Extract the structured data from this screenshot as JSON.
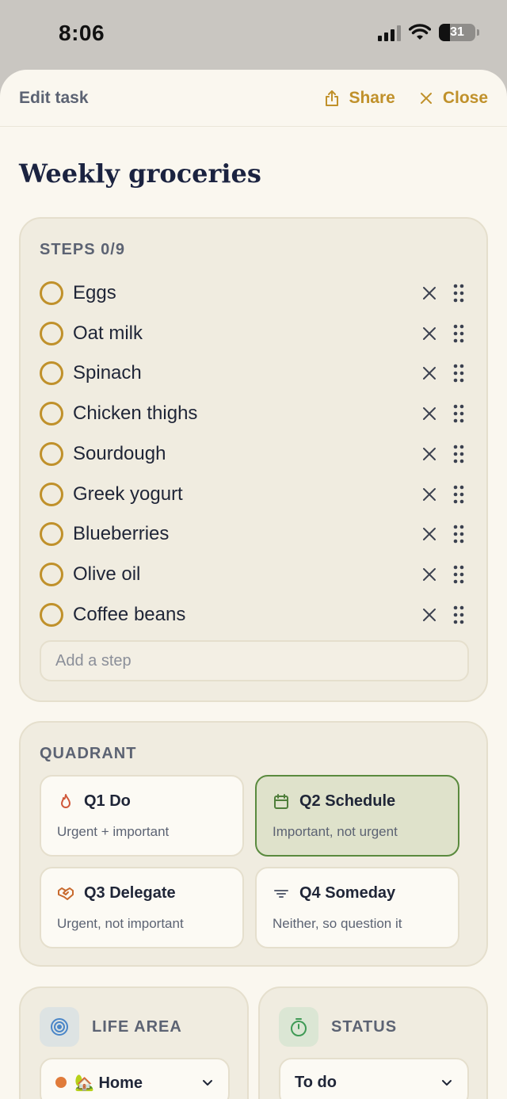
{
  "status_bar": {
    "time": "8:06",
    "battery": "31"
  },
  "header": {
    "edit_label": "Edit task",
    "share_label": "Share",
    "close_label": "Close"
  },
  "task": {
    "title": "Weekly groceries"
  },
  "steps": {
    "label": "STEPS 0/9",
    "items": [
      {
        "text": "Eggs"
      },
      {
        "text": "Oat milk"
      },
      {
        "text": "Spinach"
      },
      {
        "text": "Chicken thighs"
      },
      {
        "text": "Sourdough"
      },
      {
        "text": "Greek yogurt"
      },
      {
        "text": "Blueberries"
      },
      {
        "text": "Olive oil"
      },
      {
        "text": "Coffee beans"
      }
    ],
    "add_placeholder": "Add a step"
  },
  "quadrant": {
    "label": "QUADRANT",
    "options": [
      {
        "title": "Q1 Do",
        "subtitle": "Urgent + important",
        "icon": "flame-icon",
        "selected": false
      },
      {
        "title": "Q2 Schedule",
        "subtitle": "Important, not urgent",
        "icon": "calendar-icon",
        "selected": true
      },
      {
        "title": "Q3 Delegate",
        "subtitle": "Urgent, not important",
        "icon": "handshake-icon",
        "selected": false
      },
      {
        "title": "Q4 Someday",
        "subtitle": "Neither, so question it",
        "icon": "filter-lines-icon",
        "selected": false
      }
    ]
  },
  "life_area": {
    "label": "LIFE AREA",
    "value": "🏡 Home",
    "icon": "target-icon",
    "dot_color": "#e07b3a"
  },
  "status": {
    "label": "STATUS",
    "value": "To do",
    "icon": "timer-icon"
  },
  "colors": {
    "accent": "#c0912b",
    "selected_border": "#5a8a3e",
    "selected_bg": "#dfe2cb",
    "q1_icon": "#d0583a",
    "q2_icon": "#4f7e3a",
    "q3_icon": "#c86a2e",
    "q4_icon": "#5c6373",
    "life_icon": "#4a86c8",
    "status_icon": "#3f9a55"
  }
}
